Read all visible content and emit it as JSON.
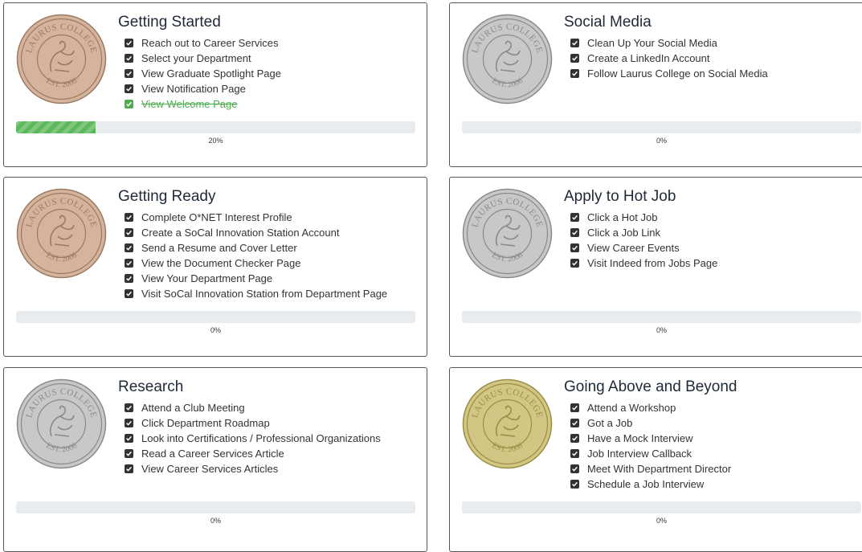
{
  "colors": {
    "bronze": "#d5b39c",
    "silver": "#c8c8c8",
    "gold": "#d2c685",
    "progress_fill": "#5cb85c",
    "progress_track": "#e9ecef",
    "done_text": "#4cae4c",
    "checkbox": "#333333"
  },
  "medal_text": {
    "top": "LAURUS COLLEGE",
    "bottom": "EST. 2006"
  },
  "cards": [
    {
      "title": "Getting Started",
      "medal": "bronze",
      "tasks": [
        {
          "label": "Reach out to Career Services",
          "done": false
        },
        {
          "label": "Select your Department",
          "done": false
        },
        {
          "label": "View Graduate Spotlight Page",
          "done": false
        },
        {
          "label": "View Notification Page",
          "done": false
        },
        {
          "label": "View Welcome Page",
          "done": true
        }
      ],
      "progress": 20,
      "progress_label": "20%"
    },
    {
      "title": "Social Media",
      "medal": "silver",
      "tasks": [
        {
          "label": "Clean Up Your Social Media",
          "done": false
        },
        {
          "label": "Create a LinkedIn Account",
          "done": false
        },
        {
          "label": "Follow Laurus College on Social Media",
          "done": false
        }
      ],
      "progress": 0,
      "progress_label": "0%"
    },
    {
      "title": "Getting Ready",
      "medal": "bronze",
      "tasks": [
        {
          "label": "Complete O*NET Interest Profile",
          "done": false
        },
        {
          "label": "Create a SoCal Innovation Station Account",
          "done": false
        },
        {
          "label": "Send a Resume and Cover Letter",
          "done": false
        },
        {
          "label": "View the Document Checker Page",
          "done": false
        },
        {
          "label": "View Your Department Page",
          "done": false
        },
        {
          "label": "Visit SoCal Innovation Station from Department Page",
          "done": false
        }
      ],
      "progress": 0,
      "progress_label": "0%"
    },
    {
      "title": "Apply to Hot Job",
      "medal": "silver",
      "tasks": [
        {
          "label": "Click a Hot Job",
          "done": false
        },
        {
          "label": "Click a Job Link",
          "done": false
        },
        {
          "label": "View Career Events",
          "done": false
        },
        {
          "label": "Visit Indeed from Jobs Page",
          "done": false
        }
      ],
      "progress": 0,
      "progress_label": "0%"
    },
    {
      "title": "Research",
      "medal": "silver",
      "tasks": [
        {
          "label": "Attend a Club Meeting",
          "done": false
        },
        {
          "label": "Click Department Roadmap",
          "done": false
        },
        {
          "label": "Look into Certifications / Professional Organizations",
          "done": false
        },
        {
          "label": "Read a Career Services Article",
          "done": false
        },
        {
          "label": "View Career Services Articles",
          "done": false
        }
      ],
      "progress": 0,
      "progress_label": "0%"
    },
    {
      "title": "Going Above and Beyond",
      "medal": "gold",
      "tasks": [
        {
          "label": "Attend a Workshop",
          "done": false
        },
        {
          "label": "Got a Job",
          "done": false
        },
        {
          "label": "Have a Mock Interview",
          "done": false
        },
        {
          "label": "Job Interview Callback",
          "done": false
        },
        {
          "label": "Meet With Department Director",
          "done": false
        },
        {
          "label": "Schedule a Job Interview",
          "done": false
        }
      ],
      "progress": 0,
      "progress_label": "0%"
    }
  ]
}
